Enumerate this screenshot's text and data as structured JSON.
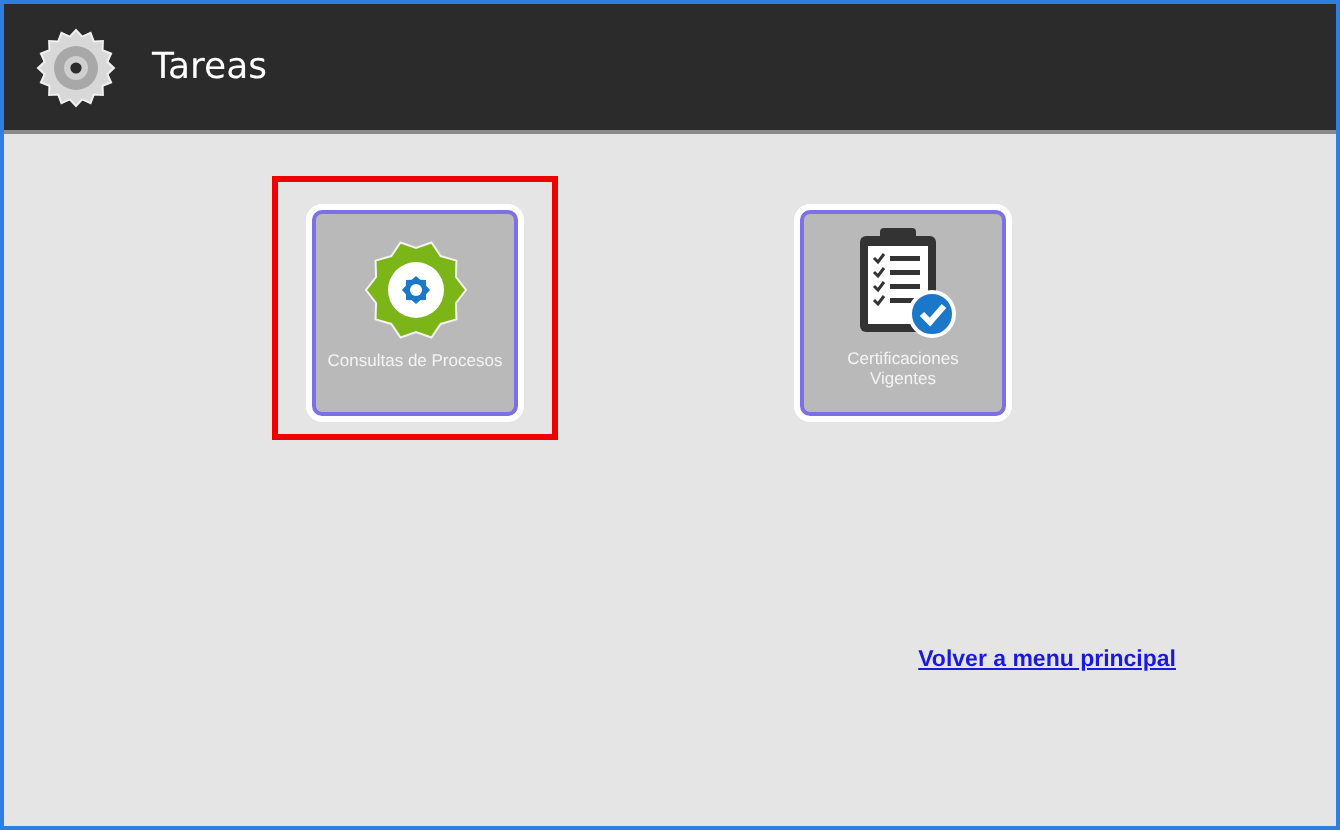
{
  "header": {
    "title": "Tareas"
  },
  "tiles": [
    {
      "kind": "gear",
      "label": "Consultas de Procesos",
      "selected": true
    },
    {
      "kind": "clipboard",
      "label": "Certificaciones Vigentes",
      "selected": false
    }
  ],
  "link": "Volver a menu principal"
}
